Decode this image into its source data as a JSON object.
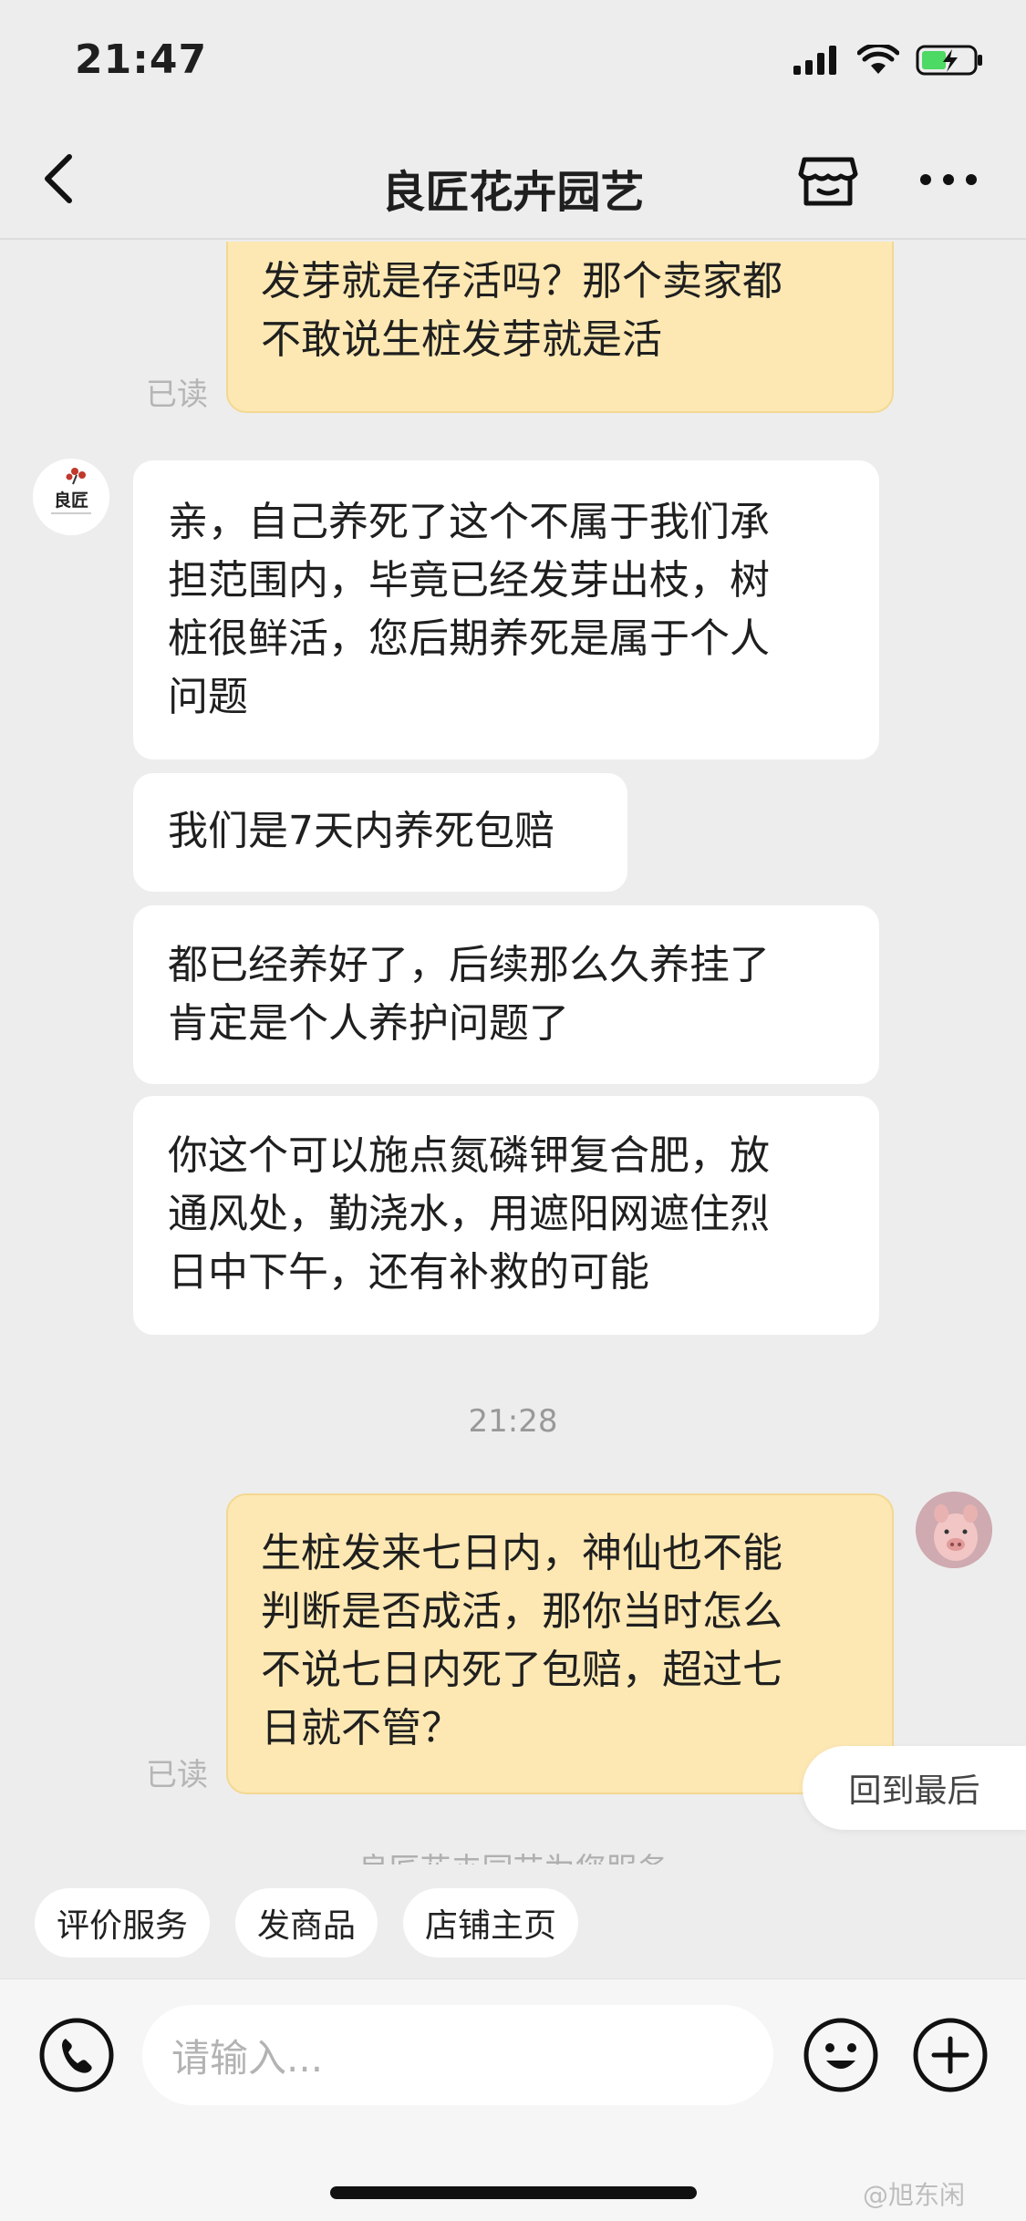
{
  "status_bar": {
    "time": "21:47"
  },
  "nav": {
    "title": "良匠花卉园艺"
  },
  "messages": [
    {
      "type": "out",
      "text_lines": [
        "发芽就是存活吗？那个卖家都",
        "不敢说生桩发芽就是活"
      ],
      "read": "已读"
    },
    {
      "type": "in",
      "text_lines": [
        "亲，自己养死了这个不属于我们承",
        "担范围内，毕竟已经发芽出枝，树",
        "桩很鲜活，您后期养死是属于个人",
        "问题"
      ]
    },
    {
      "type": "in",
      "text_lines": [
        "我们是7天内养死包赔"
      ]
    },
    {
      "type": "in",
      "text_lines": [
        "都已经养好了，后续那么久养挂了",
        "肯定是个人养护问题了"
      ]
    },
    {
      "type": "in",
      "text_lines": [
        "你这个可以施点氮磷钾复合肥，放",
        "通风处，勤浇水，用遮阳网遮住烈",
        "日中下午，还有补救的可能"
      ]
    },
    {
      "type": "time",
      "text": "21:28"
    },
    {
      "type": "out",
      "text_lines": [
        "生桩发来七日内，神仙也不能",
        "判断是否成活，那你当时怎么",
        "不说七日内死了包赔，超过七",
        "日就不管？"
      ],
      "read": "已读"
    }
  ],
  "shop_avatar_text": "良匠",
  "back_to_last": "回到最后",
  "partial_text": "良匠花卉园艺为您服务",
  "quick_actions": [
    "评价服务",
    "发商品",
    "店铺主页"
  ],
  "input": {
    "placeholder": "请输入..."
  },
  "watermark": "@旭东闲"
}
